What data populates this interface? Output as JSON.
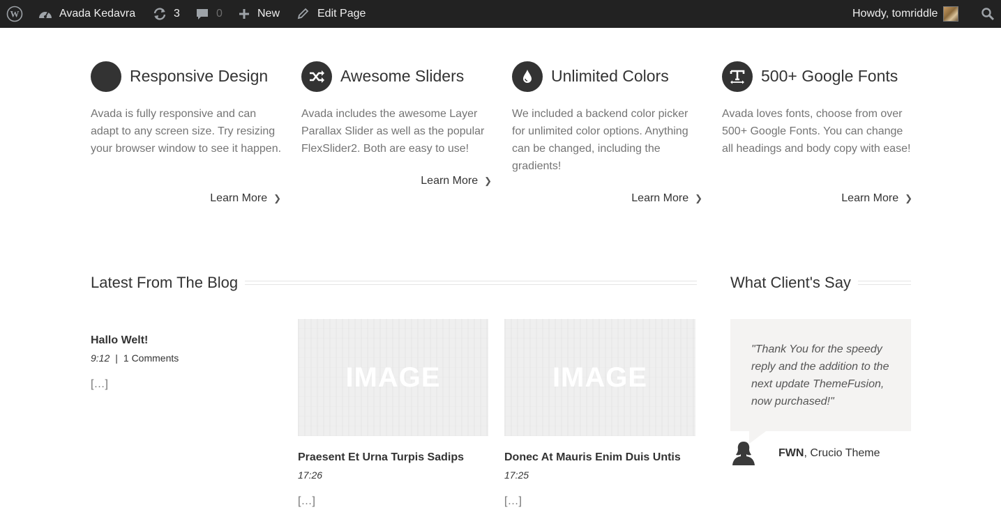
{
  "adminbar": {
    "site_name": "Avada Kedavra",
    "updates_count": "3",
    "comments_count": "0",
    "new_label": "New",
    "edit_label": "Edit Page",
    "howdy": "Howdy, tomriddle",
    "icons": [
      "wordpress-logo-icon",
      "dashboard-icon",
      "updates-icon",
      "comments-icon",
      "plus-icon",
      "pencil-icon",
      "search-icon"
    ]
  },
  "features": [
    {
      "title": "Responsive Design",
      "text": "Avada is fully responsive and can adapt to any screen size. Try resizing your browser window to see it happen.",
      "link": "Learn More",
      "icon": "responsive-icon"
    },
    {
      "title": "Awesome Sliders",
      "text": "Avada includes the awesome Layer Parallax Slider as well as the popular FlexSlider2. Both are easy to use!",
      "link": "Learn More",
      "icon": "shuffle-icon"
    },
    {
      "title": "Unlimited Colors",
      "text": "We included a backend color picker for unlimited color options. Anything can be changed, including the gradients!",
      "link": "Learn More",
      "icon": "drop-icon"
    },
    {
      "title": "500+ Google Fonts",
      "text": "Avada loves fonts, choose from over 500+ Google Fonts. You can change all headings and body copy with ease!",
      "link": "Learn More",
      "icon": "text-height-icon"
    }
  ],
  "blog": {
    "heading": "Latest From The Blog",
    "posts": [
      {
        "title": "Hallo Welt!",
        "time": "9:12",
        "comments": "1 Comments",
        "excerpt": "[…]"
      },
      {
        "title": "Praesent Et Urna Turpis Sadips",
        "time": "17:26",
        "excerpt": "[…]",
        "image_label": "IMAGE"
      },
      {
        "title": "Donec At Mauris Enim Duis Untis",
        "time": "17:25",
        "excerpt": "[…]",
        "image_label": "IMAGE"
      }
    ]
  },
  "testimonial": {
    "heading": "What Client's Say",
    "quote": "\"Thank You for the speedy reply and the addition to the next update ThemeFusion, now purchased!\"",
    "author": "FWN",
    "company": ", Crucio Theme"
  },
  "colors": {
    "adminbar_bg": "#222222",
    "icon_circle": "#333333",
    "body_text": "#747474",
    "quote_bg": "#f4f3f2"
  }
}
